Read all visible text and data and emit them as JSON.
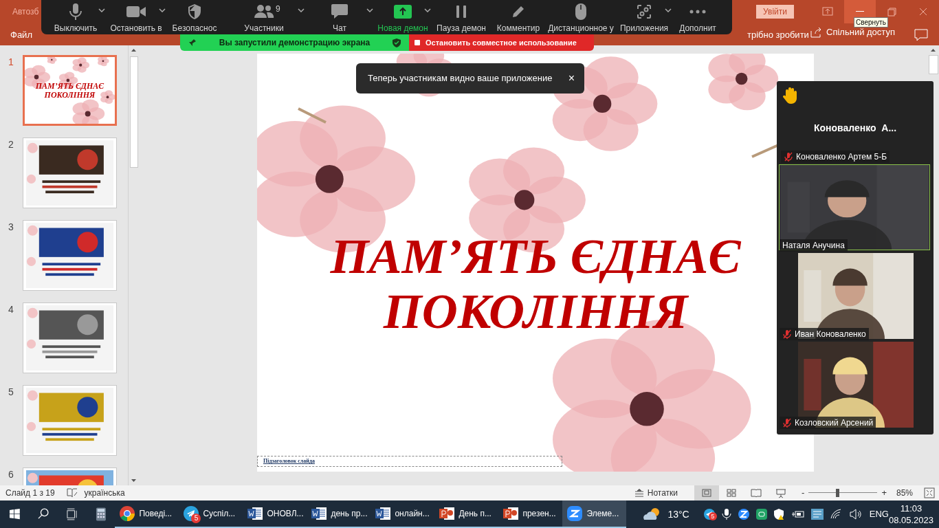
{
  "powerpoint": {
    "title": "Автозб",
    "sign_in": "Увійти",
    "file_tab": "Файл",
    "tell_me": "трібно зробити",
    "share": "Спільний доступ",
    "tooltip": "Свернуть"
  },
  "zoom_toolbar": {
    "participant_count": "9",
    "buttons": [
      {
        "kind": "mic",
        "label": "Выключить",
        "caret": true
      },
      {
        "kind": "video",
        "label": "Остановить в",
        "caret": true
      },
      {
        "kind": "security",
        "label": "Безопаснос",
        "caret": false
      },
      {
        "kind": "participants",
        "label": "Участники",
        "caret": true
      },
      {
        "kind": "chat",
        "label": "Чат",
        "caret": true
      },
      {
        "kind": "share",
        "label": "Новая демон",
        "caret": true
      },
      {
        "kind": "pause",
        "label": "Пауза демон",
        "caret": false
      },
      {
        "kind": "annotate",
        "label": "Комментир",
        "caret": false
      },
      {
        "kind": "remote",
        "label": "Дистанционное у",
        "caret": false
      },
      {
        "kind": "apps",
        "label": "Приложения",
        "caret": true
      },
      {
        "kind": "more",
        "label": "Дополнит",
        "caret": false
      }
    ]
  },
  "share_banner": {
    "status": "Вы запустили демонстрацию экрана",
    "stop": "Остановить совместное использование"
  },
  "toast": {
    "text": "Теперь участникам видно ваше приложение",
    "close": "×"
  },
  "slides": [
    {
      "number": "1",
      "selected": true,
      "kind": "title",
      "title": "ПАМ’ЯТЬ ЄДНАЄ ПОКОЛІННЯ"
    },
    {
      "number": "2",
      "selected": false,
      "kind": "picture"
    },
    {
      "number": "3",
      "selected": false,
      "kind": "picture"
    },
    {
      "number": "4",
      "selected": false,
      "kind": "picture"
    },
    {
      "number": "5",
      "selected": false,
      "kind": "picture"
    },
    {
      "number": "6",
      "selected": false,
      "kind": "picture"
    }
  ],
  "slide": {
    "title_lines": [
      "ПАМ’ЯТЬ ЄДНАЄ",
      "ПОКОЛІННЯ"
    ],
    "subtitle_placeholder": "Підзаголовок слайда"
  },
  "video_panel": {
    "raised_hand": true,
    "featured_name": "Коноваленко  А...",
    "tiles": [
      {
        "kind": "name",
        "name": "Коноваленко Артем 5-Б",
        "muted": true,
        "speaking": false
      },
      {
        "kind": "video",
        "name": "Наталя Анучина",
        "muted": false,
        "speaking": true
      },
      {
        "kind": "video",
        "name": "Иван Коноваленко",
        "muted": true,
        "speaking": false
      },
      {
        "kind": "video",
        "name": "Козловский Арсений",
        "muted": true,
        "speaking": false
      }
    ]
  },
  "status_bar": {
    "slide_info": "Слайд 1 з 19",
    "language": "українська",
    "notes": "Нотатки",
    "views": [
      {
        "kind": "normal",
        "selected": true
      },
      {
        "kind": "sorter",
        "selected": false
      },
      {
        "kind": "reading",
        "selected": false
      },
      {
        "kind": "slideshow",
        "selected": false
      }
    ],
    "zoom": {
      "minus": "-",
      "plus": "+",
      "level": 0.42,
      "reading": "85%"
    }
  },
  "taskbar": {
    "apps": [
      {
        "kind": "chrome",
        "label": "Поведі...",
        "active": false
      },
      {
        "kind": "telegram",
        "label": "Суспіл...",
        "badge": "5",
        "active": false
      },
      {
        "kind": "word",
        "label": "ОНОВЛ...",
        "active": false
      },
      {
        "kind": "word",
        "label": "день пр...",
        "active": false
      },
      {
        "kind": "word",
        "label": "онлайн...",
        "active": false
      },
      {
        "kind": "powerpoint",
        "label": "День п...",
        "active": false
      },
      {
        "kind": "powerpoint",
        "label": "презен...",
        "active": false
      },
      {
        "kind": "zoom",
        "label": "Элеме...",
        "active": true
      }
    ],
    "temperature": "13°C",
    "tray_badge": "5",
    "language": "ENG",
    "time": "11:03",
    "date": "08.05.2023"
  }
}
